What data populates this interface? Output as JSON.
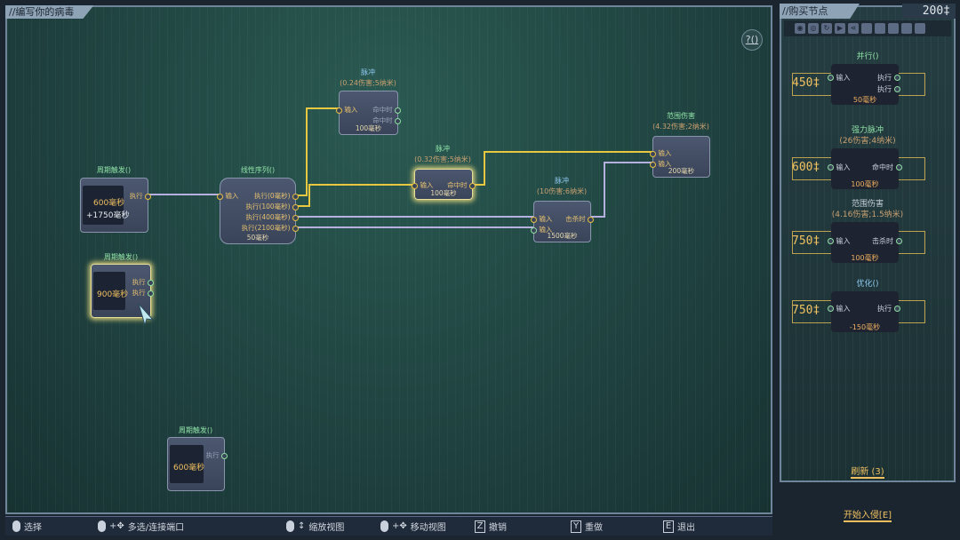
{
  "editor": {
    "title": "//编写你的病毒",
    "help": "?()"
  },
  "nodes": {
    "trig1": {
      "name": "周期触发()",
      "value": "600毫秒",
      "extra": "+1750毫秒",
      "out": "执行"
    },
    "trig2": {
      "name": "周期触发()",
      "value": "900毫秒",
      "out1": "执行",
      "out2": "执行"
    },
    "trig3": {
      "name": "周期触发()",
      "value": "600毫秒",
      "out": "执行"
    },
    "seq": {
      "name": "线性序列()",
      "in": "输入",
      "outs": [
        "执行(0毫秒)",
        "执行(100毫秒)",
        "执行(400毫秒)",
        "执行(2100毫秒)"
      ],
      "time": "50毫秒"
    },
    "pulse1": {
      "name": "脉冲",
      "stats": "(0.24伤害;5纳米)",
      "in": "输入",
      "out1": "命中时",
      "out2": "命中时",
      "time": "100毫秒"
    },
    "pulse2": {
      "name": "脉冲",
      "stats": "(0.32伤害;5纳米)",
      "in": "输入",
      "out": "命中时",
      "time": "100毫秒"
    },
    "pulse3": {
      "name": "脉冲",
      "stats": "(10伤害;6纳米)",
      "in1": "输入",
      "in2": "输入",
      "out": "击杀时",
      "time": "1500毫秒"
    },
    "aoe": {
      "name": "范围伤害",
      "stats": "(4.32伤害;2纳米)",
      "in1": "输入",
      "in2": "输入",
      "time": "200毫秒"
    }
  },
  "shop": {
    "title": "//购买节点",
    "currency": "200‡",
    "items": [
      {
        "name": "并行()",
        "stats": "",
        "price": "450‡",
        "in": "输入",
        "out1": "执行",
        "out2": "执行",
        "time": "50毫秒"
      },
      {
        "name": "强力脉冲",
        "stats": "(26伤害;4纳米)",
        "price": "600‡",
        "in": "输入",
        "out1": "命中时",
        "time": "100毫秒"
      },
      {
        "name": "范围伤害",
        "stats": "(4.16伤害;1.5纳米)",
        "price": "750‡",
        "in": "输入",
        "out1": "击杀时",
        "time": "100毫秒"
      },
      {
        "name": "优化()",
        "stats": "",
        "price": "750‡",
        "in": "输入",
        "out1": "执行",
        "time": "-150毫秒"
      }
    ],
    "refresh": "刷新 (3)",
    "start": "开始入侵[E]"
  },
  "hints": [
    {
      "key": "",
      "label": "选择"
    },
    {
      "key": "",
      "label": "多选/连接端口"
    },
    {
      "key": "",
      "label": "缩放视图"
    },
    {
      "key": "",
      "label": "移动视图"
    },
    {
      "key": "Z",
      "label": "撤销"
    },
    {
      "key": "Y",
      "label": "重做"
    },
    {
      "key": "E",
      "label": "退出"
    }
  ],
  "colors": {
    "wire_active": "#e8c840",
    "wire_idle": "#b6b0e0",
    "accent": "#f0c060"
  }
}
